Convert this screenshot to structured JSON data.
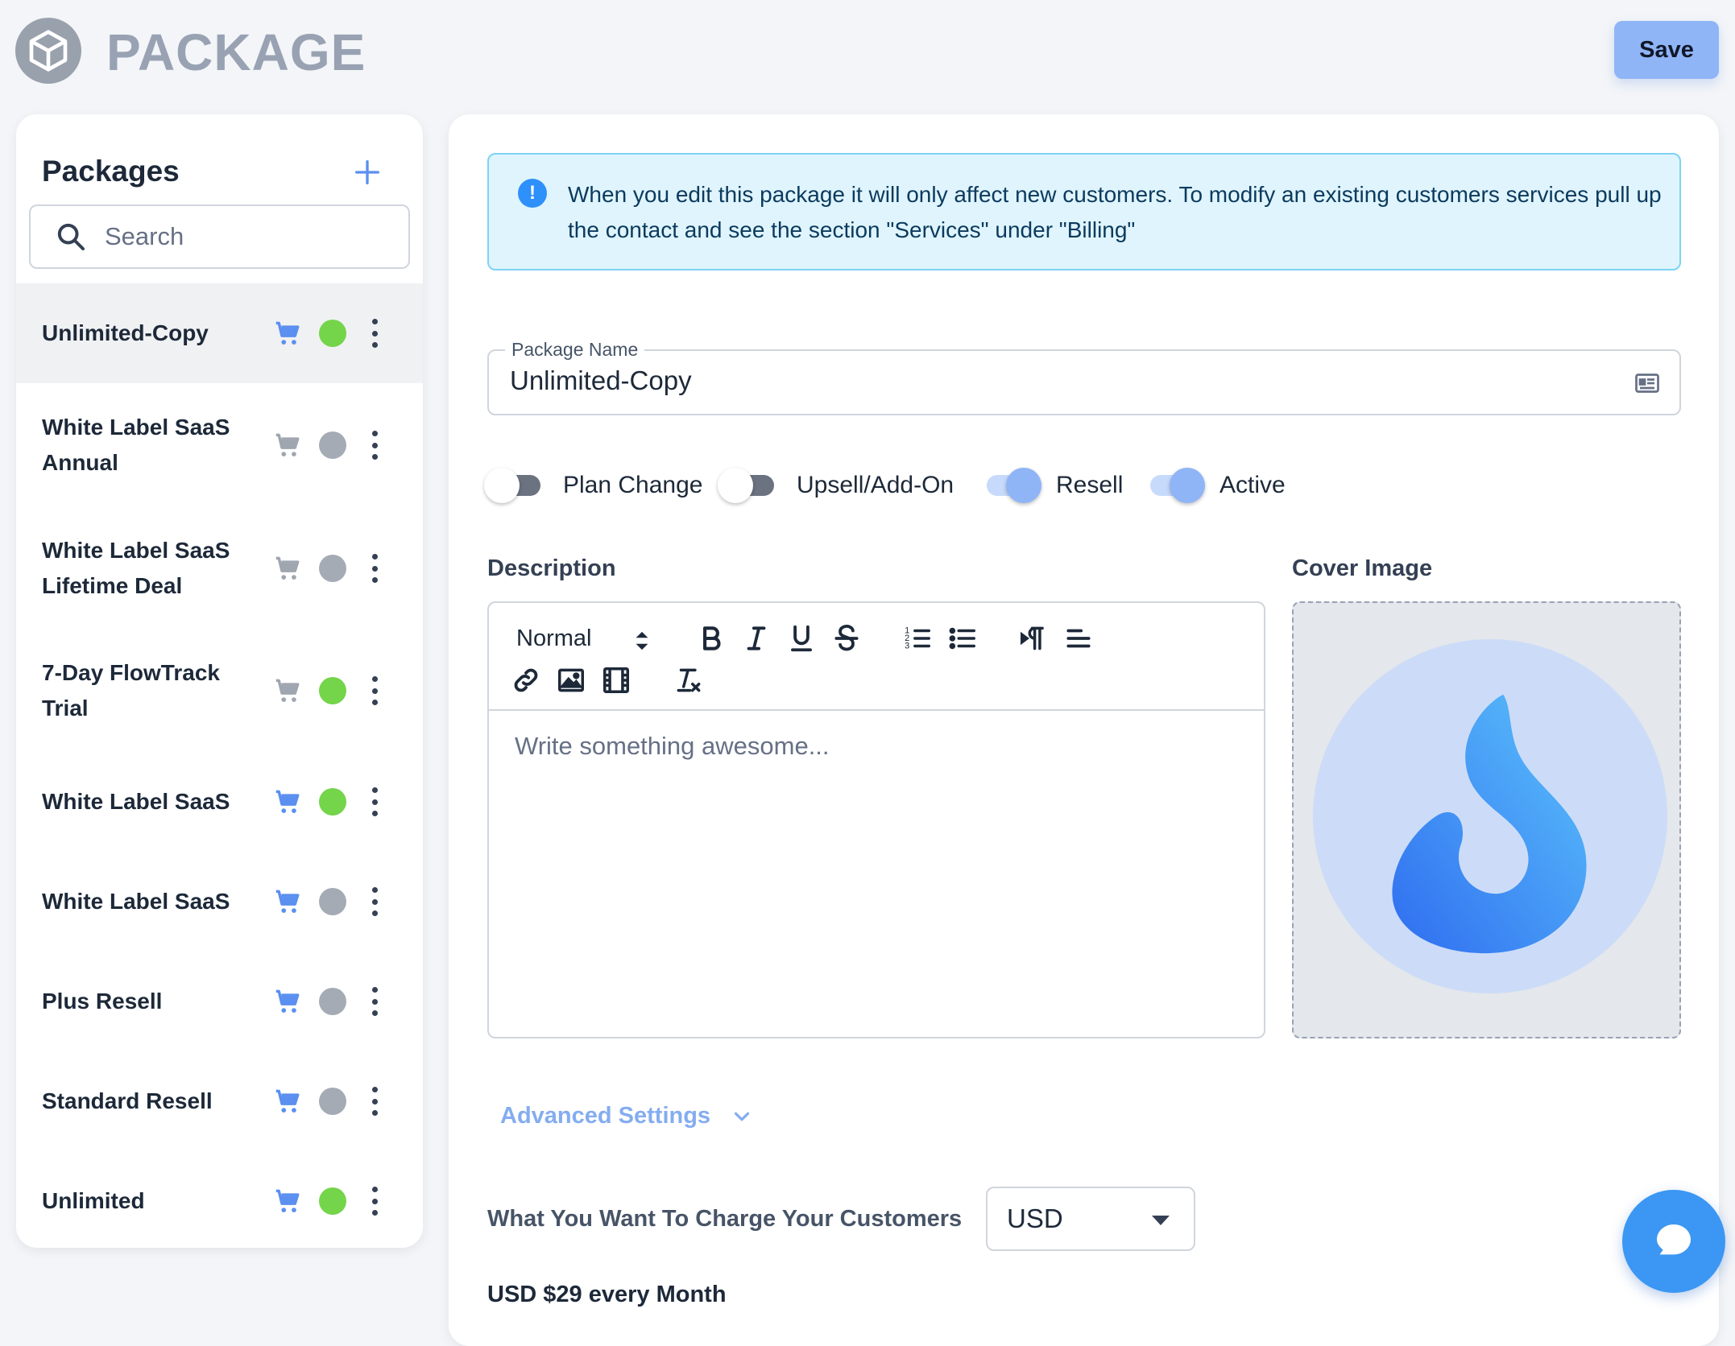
{
  "header": {
    "title": "PACKAGE",
    "logo_icon": "package-box-icon",
    "save_label": "Save"
  },
  "sidebar": {
    "title": "Packages",
    "add_icon": "plus-icon",
    "search": {
      "placeholder": "Search",
      "icon": "search-icon"
    },
    "items": [
      {
        "name": "Unlimited-Copy",
        "cart_color": "#5b8ff0",
        "status": "active",
        "status_color": "#74d44a",
        "selected": true
      },
      {
        "name": "White Label SaaS Annual",
        "cart_color": "#a0a6b0",
        "status": "inactive",
        "status_color": "#a4abb5",
        "selected": false
      },
      {
        "name": "White Label SaaS Lifetime Deal",
        "cart_color": "#a0a6b0",
        "status": "inactive",
        "status_color": "#a4abb5",
        "selected": false
      },
      {
        "name": "7-Day FlowTrack Trial",
        "cart_color": "#a0a6b0",
        "status": "active",
        "status_color": "#74d44a",
        "selected": false
      },
      {
        "name": "White Label SaaS",
        "cart_color": "#5b8ff0",
        "status": "active",
        "status_color": "#74d44a",
        "selected": false
      },
      {
        "name": "White Label SaaS",
        "cart_color": "#5b8ff0",
        "status": "inactive",
        "status_color": "#a4abb5",
        "selected": false
      },
      {
        "name": "Plus Resell",
        "cart_color": "#5b8ff0",
        "status": "inactive",
        "status_color": "#a4abb5",
        "selected": false
      },
      {
        "name": "Standard Resell",
        "cart_color": "#5b8ff0",
        "status": "inactive",
        "status_color": "#a4abb5",
        "selected": false
      },
      {
        "name": "Unlimited",
        "cart_color": "#5b8ff0",
        "status": "active",
        "status_color": "#74d44a",
        "selected": false
      }
    ]
  },
  "main": {
    "alert": {
      "icon": "info-icon",
      "text": "When you edit this package it will only affect new customers. To modify an existing customers services pull up the contact and see the section \"Services\" under \"Billing\""
    },
    "package_name": {
      "label": "Package Name",
      "value": "Unlimited-Copy",
      "icon": "contact-card-icon"
    },
    "toggles": [
      {
        "label": "Plan Change",
        "on": false
      },
      {
        "label": "Upsell/Add-On",
        "on": false
      },
      {
        "label": "Resell",
        "on": true
      },
      {
        "label": "Active",
        "on": true
      }
    ],
    "description": {
      "label": "Description",
      "format": "Normal",
      "placeholder": "Write something awesome..."
    },
    "cover_image": {
      "label": "Cover Image",
      "icon": "flame-logo-icon"
    },
    "advanced_settings": {
      "label": "Advanced Settings"
    },
    "charge": {
      "label": "What You Want To Charge Your Customers",
      "currency": "USD",
      "summary": "USD $29 every Month"
    }
  },
  "colors": {
    "accent": "#8fb5f7",
    "active_status": "#74d44a",
    "inactive_status": "#a4abb5",
    "alert_bg": "#dff4fc"
  }
}
